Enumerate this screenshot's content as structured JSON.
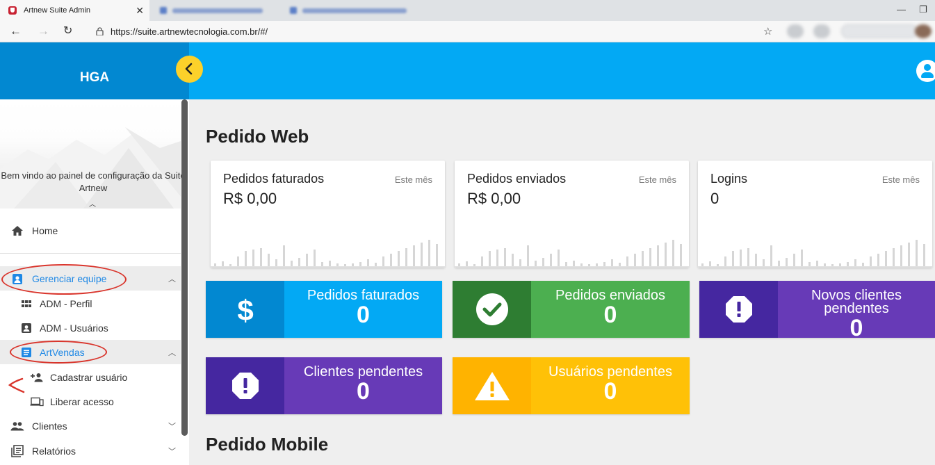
{
  "browser": {
    "tab_title": "Artnew Suite Admin",
    "tab_close": "✕",
    "url": "https://suite.artnewtecnologia.com.br/#/"
  },
  "sidebar": {
    "title": "HGA",
    "welcome": "Bem vindo ao painel de configuração da Suite Artnew",
    "items": [
      {
        "label": "Home",
        "icon": "home-icon"
      },
      {
        "label": "Gerenciar equipe",
        "icon": "badge-icon",
        "expanded": true,
        "selected": true
      },
      {
        "label": "ADM - Perfil",
        "icon": "grid-icon"
      },
      {
        "label": "ADM - Usuários",
        "icon": "user-card-icon"
      },
      {
        "label": "ArtVendas",
        "icon": "receipt-icon",
        "expanded": true,
        "selected": true
      },
      {
        "label": "Cadastrar usuário",
        "icon": "person-add-icon"
      },
      {
        "label": "Liberar acesso",
        "icon": "devices-icon"
      },
      {
        "label": "Clientes",
        "icon": "people-icon"
      },
      {
        "label": "Relatórios",
        "icon": "report-icon"
      }
    ]
  },
  "main": {
    "section_web": "Pedido Web",
    "section_mobile": "Pedido Mobile",
    "cards": [
      {
        "title": "Pedidos faturados",
        "period": "Este mês",
        "value": "R$ 0,00"
      },
      {
        "title": "Pedidos enviados",
        "period": "Este mês",
        "value": "R$ 0,00"
      },
      {
        "title": "Logins",
        "period": "Este mês",
        "value": "0"
      }
    ],
    "tiles": [
      {
        "label": "Pedidos faturados",
        "value": "0",
        "icon": "dollar-icon",
        "color": "#03a9f4",
        "icon_bg": "#0288d1"
      },
      {
        "label": "Pedidos enviados",
        "value": "0",
        "icon": "check-circle-icon",
        "color": "#4caf50",
        "icon_bg": "#2e7d32"
      },
      {
        "label": "Novos clientes pendentes",
        "value": "0",
        "icon": "alert-octagon-icon",
        "color": "#673ab7",
        "icon_bg": "#4527a0"
      },
      {
        "label": "Clientes pendentes",
        "value": "0",
        "icon": "alert-octagon-icon",
        "color": "#673ab7",
        "icon_bg": "#4527a0"
      },
      {
        "label": "Usuários pendentes",
        "value": "0",
        "icon": "warning-icon",
        "color": "#ffc107",
        "icon_bg": "#ffb300"
      }
    ]
  },
  "colors": {
    "primary": "#03a9f4",
    "primary_dark": "#0288d1",
    "accent": "#fcd12a",
    "selected_text": "#1e88e5",
    "annotation": "#d9342b"
  }
}
